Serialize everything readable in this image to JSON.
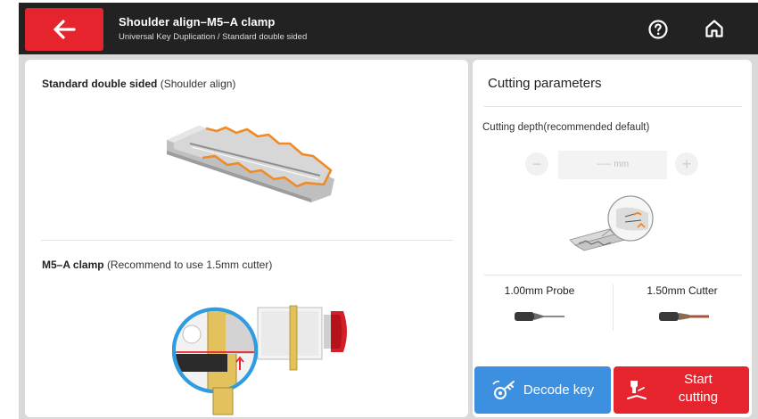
{
  "header": {
    "title": "Shoulder align–M5–A clamp",
    "subtitle": "Universal Key Duplication / Standard double sided"
  },
  "left_panel": {
    "section1": {
      "label": "Standard double sided",
      "note": "(Shoulder align)"
    },
    "section2": {
      "label": "M5–A clamp",
      "note": "(Recommend to use 1.5mm cutter)"
    }
  },
  "right_panel": {
    "title": "Cutting parameters",
    "depth_label": "Cutting depth(recommended default)",
    "depth_value": "----- mm",
    "minus_label": "−",
    "plus_label": "+",
    "probe_label": "1.00mm Probe",
    "cutter_label": "1.50mm Cutter"
  },
  "buttons": {
    "decode": "Decode key",
    "start_line1": "Start",
    "start_line2": "cutting"
  },
  "icons": {
    "back": "arrow-left-icon",
    "help": "question-circle-icon",
    "home": "home-icon",
    "decode": "key-decode-icon",
    "cut": "cutter-icon"
  },
  "colors": {
    "accent_red": "#e5242d",
    "accent_blue": "#3d8fe0",
    "topbar": "#222222",
    "key_outline": "#f08a24"
  }
}
